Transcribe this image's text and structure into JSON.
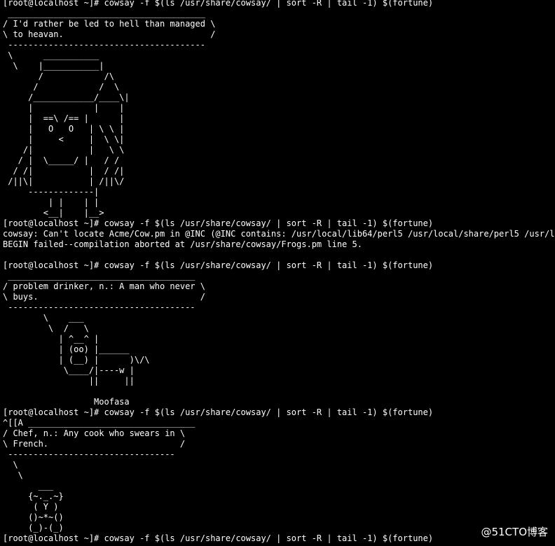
{
  "terminal": {
    "lines": [
      "[root@localhost ~]# cowsay -f $(ls /usr/share/cowsay/ | sort -R | tail -1) $(fortune)",
      " _______________________________________",
      "/ I'd rather be led to hell than managed \\",
      "\\ to heavan.                             /",
      " ---------------------------------------",
      " \\      ___________",
      "  \\    |___________|",
      "       /            /\\",
      "      /            /  \\",
      "     /____________/____\\|",
      "     |            |    |",
      "     |  ==\\ /== |      |",
      "     |   O   O   | \\ \\ |",
      "     |     <     |  \\ \\|",
      "    /|           |   \\ \\",
      "   / |  \\_____/ |   / /",
      "  / /|           |  / /|",
      " /||\\|           | /||\\/",
      "     -------------|",
      "         | |    | |",
      "        <__|    |__>",
      "[root@localhost ~]# cowsay -f $(ls /usr/share/cowsay/ | sort -R | tail -1) $(fortune)",
      "cowsay: Can't locate Acme/Cow.pm in @INC (@INC contains: /usr/local/lib64/perl5 /usr/local/share/perl5 /usr/lib64",
      "BEGIN failed--compilation aborted at /usr/share/cowsay/Frogs.pm line 5.",
      "",
      "[root@localhost ~]# cowsay -f $(ls /usr/share/cowsay/ | sort -R | tail -1) $(fortune)",
      " _____________________________________",
      "/ problem drinker, n.: A man who never \\",
      "\\ buys.                                /",
      " -------------------------------------",
      "        \\    ___",
      "         \\  /   \\",
      "           | ^__^ |",
      "           | (oo) |______",
      "           | (__) |      )\\/\\",
      "            \\____/|----w |",
      "                 ||     ||",
      "",
      "                  Moofasa",
      "[root@localhost ~]# cowsay -f $(ls /usr/share/cowsay/ | sort -R | tail -1) $(fortune)",
      "^[[A _________________________________",
      "/ Chef, n.: Any cook who swears in \\",
      "\\ French.                          /",
      " ---------------------------------",
      "  \\",
      "   \\",
      "       ___",
      "     {~._.~}",
      "      ( Y )",
      "     ()~*~()",
      "     (_)-(_)",
      "[root@localhost ~]# cowsay -f $(ls /usr/share/cowsay/ | sort -R | tail -1) $(fortune)"
    ]
  },
  "watermark": "@51CTO博客",
  "colors": {
    "background": "#000000",
    "text": "#ffffff"
  }
}
